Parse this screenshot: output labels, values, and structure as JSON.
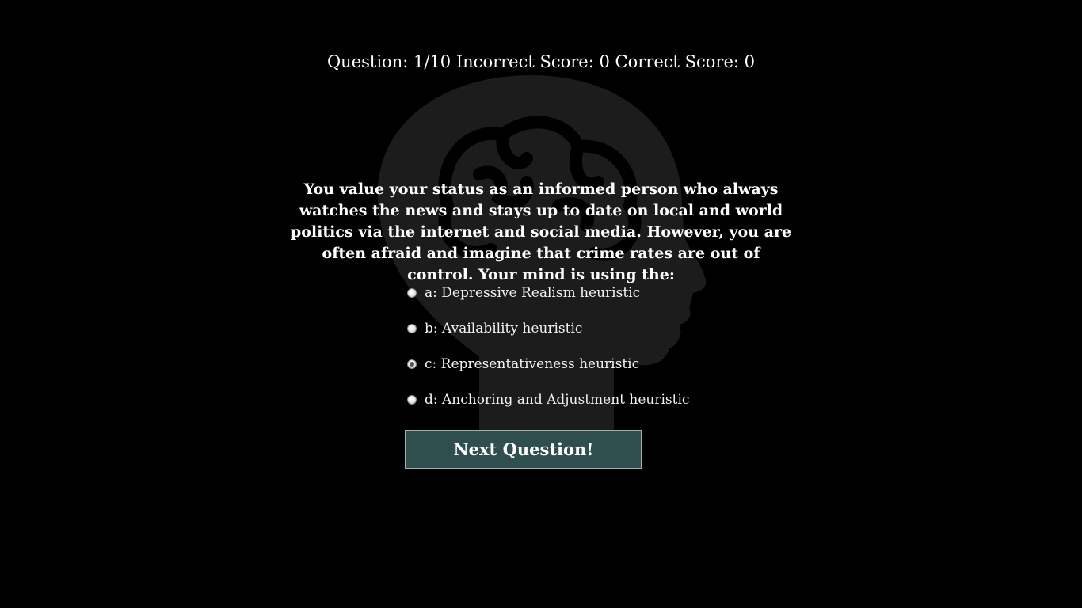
{
  "score_bar": {
    "question_label": "Question:",
    "question_progress": "1/10",
    "incorrect_label": "Incorrect Score:",
    "incorrect_score": "0",
    "correct_label": "Correct Score:",
    "correct_score": "0"
  },
  "background": {
    "icon": "head-with-brain-icon",
    "color": "#1c1c1c"
  },
  "question": {
    "text": "You value your status as an informed person who always watches the news and stays up to date on local and world politics via the internet and social media. However, you are often afraid and imagine that crime rates are out of control. Your mind is using the:"
  },
  "answers": [
    {
      "label": "a: Depressive Realism heuristic",
      "selected": false
    },
    {
      "label": "b: Availability heuristic",
      "selected": false
    },
    {
      "label": "c: Representativeness heuristic",
      "selected": true
    },
    {
      "label": "d: Anchoring and Adjustment heuristic",
      "selected": false
    }
  ],
  "next_button": {
    "label": "Next Question!",
    "color": "#2f4f4f"
  }
}
